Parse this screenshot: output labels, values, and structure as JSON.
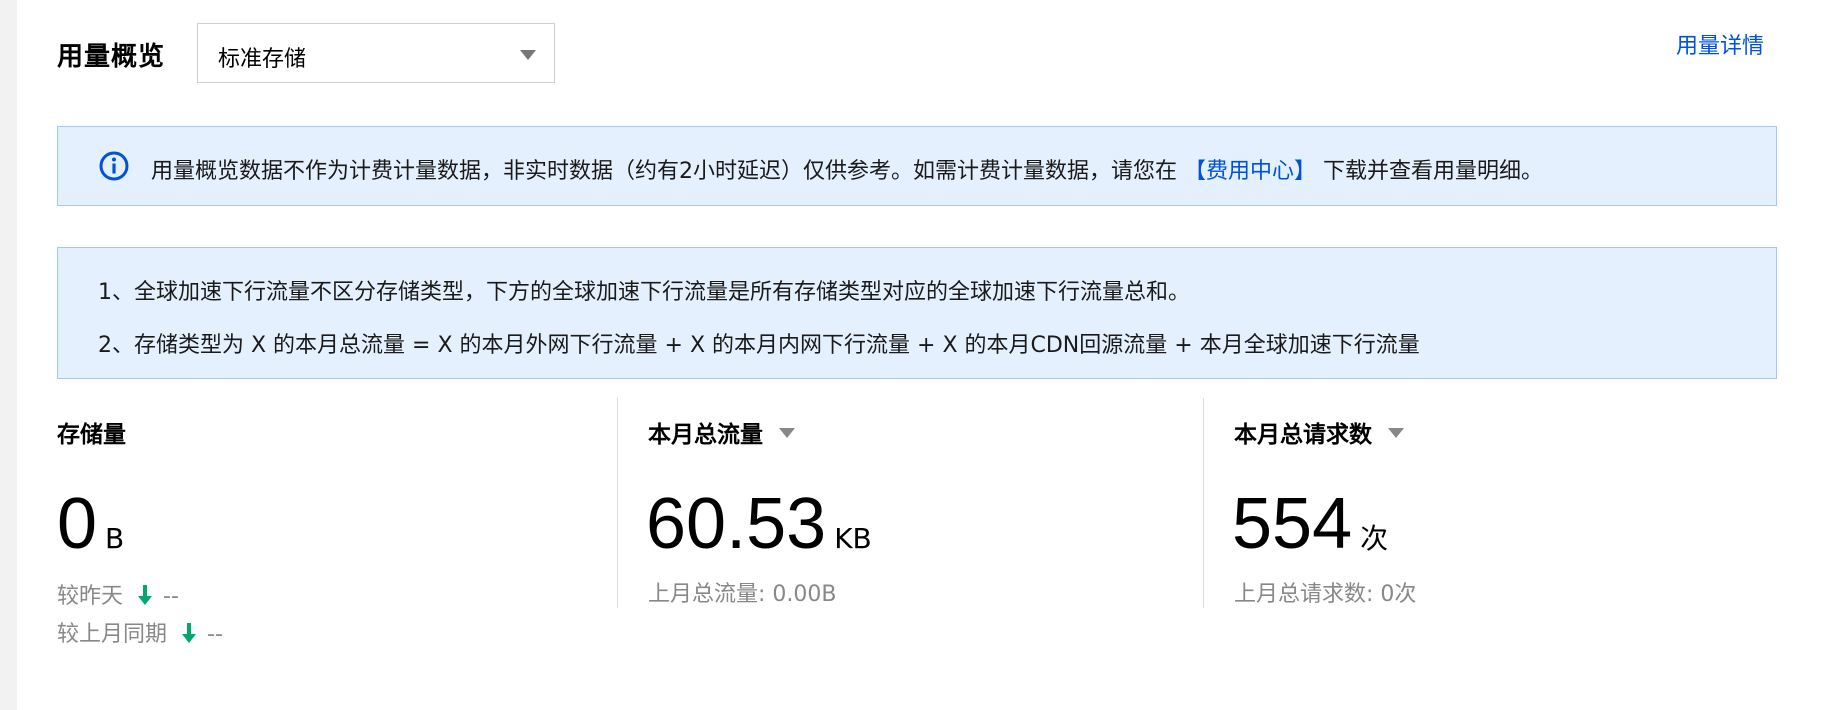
{
  "header": {
    "title": "用量概览",
    "storage_select": {
      "value": "标准存储"
    },
    "detail_link": "用量详情"
  },
  "notice": {
    "icon": "info-icon",
    "text_before": "用量概览数据不作为计费计量数据，非实时数据（约有2小时延迟）仅供参考。如需计费计量数据，请您在 ",
    "link": "【费用中心】",
    "text_after": " 下载并查看用量明细。"
  },
  "notes": [
    "1、全球加速下行流量不区分存储类型，下方的全球加速下行流量是所有存储类型对应的全球加速下行流量总和。",
    "2、存储类型为 X 的本月总流量 = X 的本月外网下行流量 + X 的本月内网下行流量 + X 的本月CDN回源流量 + 本月全球加速下行流量"
  ],
  "stats": {
    "storage": {
      "label": "存储量",
      "value": "0",
      "unit": "B",
      "compare_yesterday_label": "较昨天",
      "compare_yesterday_value": "--",
      "compare_last_month_label": "较上月同期",
      "compare_last_month_value": "--"
    },
    "traffic": {
      "label": "本月总流量",
      "value": "60.53",
      "unit": "KB",
      "sub": "上月总流量: 0.00B"
    },
    "requests": {
      "label": "本月总请求数",
      "value": "554",
      "unit": "次",
      "sub": "上月总请求数: 0次"
    }
  },
  "colors": {
    "link": "#0052d9",
    "notice_bg": "#e5f0ff",
    "notice_border": "#a3c8f5",
    "trend_down": "#00a870"
  }
}
